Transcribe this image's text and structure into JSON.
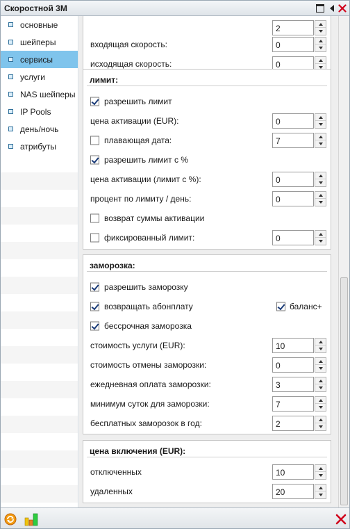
{
  "window": {
    "title": "Скоростной 3М"
  },
  "sidebar": {
    "items": [
      {
        "label": "основные"
      },
      {
        "label": "шейперы"
      },
      {
        "label": "сервисы",
        "active": true
      },
      {
        "label": "услуги"
      },
      {
        "label": "NAS шейперы"
      },
      {
        "label": "IP Pools"
      },
      {
        "label": "день/ночь"
      },
      {
        "label": "атрибуты"
      }
    ]
  },
  "speed": {
    "incoming_label": "входящая скорость:",
    "incoming_value": "0",
    "outgoing_label": "исходящая скорость:",
    "outgoing_value": "0",
    "partial_value": "2"
  },
  "limit": {
    "title": "лимит:",
    "allow_limit": "разрешить лимит",
    "activation_price": "цена активации (EUR):",
    "activation_price_value": "0",
    "floating_date": "плавающая дата:",
    "floating_date_value": "7",
    "allow_limit_pct": "разрешить лимит с %",
    "activation_price_pct": "цена активации (лимит с %):",
    "activation_price_pct_value": "0",
    "percent_per_day": "процент по лимиту / день:",
    "percent_per_day_value": "0",
    "refund_activation": "возврат суммы активации",
    "fixed_limit": "фиксированный лимит:",
    "fixed_limit_value": "0"
  },
  "freeze": {
    "title": "заморозка:",
    "allow_freeze": "разрешить заморозку",
    "return_fee": "возвращать абонплату",
    "balance_plus": "баланс+",
    "unlimited_freeze": "бессрочная заморозка",
    "service_cost": "стоимость услуги (EUR):",
    "service_cost_value": "10",
    "cancel_cost": "стоимость отмены заморозки:",
    "cancel_cost_value": "0",
    "daily_payment": "ежедневная оплата заморозки:",
    "daily_payment_value": "3",
    "min_days": "минимум суток для заморозки:",
    "min_days_value": "7",
    "free_per_year": "бесплатных заморозок в год:",
    "free_per_year_value": "2"
  },
  "activation": {
    "title": "цена включения (EUR):",
    "disabled": "отключенных",
    "disabled_value": "10",
    "deleted": "удаленных",
    "deleted_value": "20"
  }
}
